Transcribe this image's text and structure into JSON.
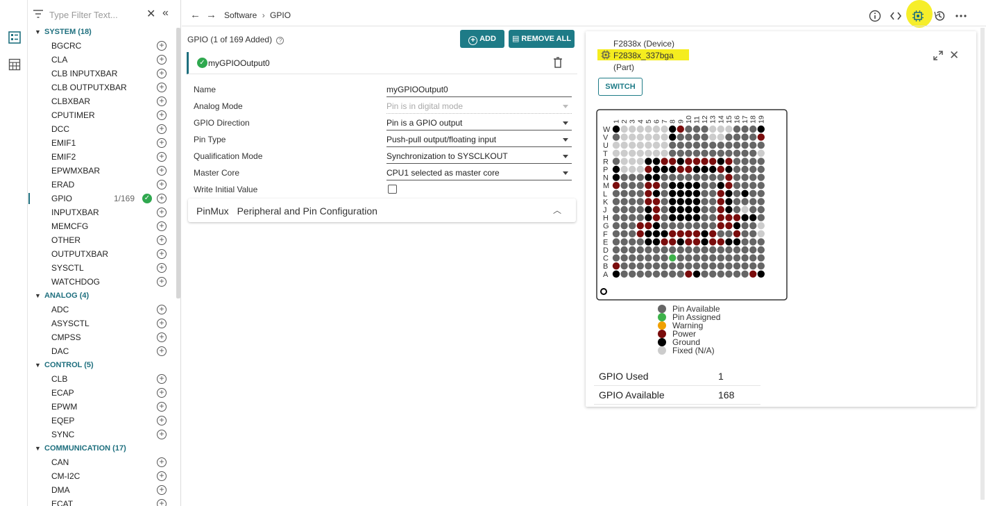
{
  "sidebar": {
    "filter_placeholder": "Type Filter Text...",
    "groups": [
      {
        "label": "SYSTEM (18)",
        "items": [
          "BGCRC",
          "CLA",
          "CLB INPUTXBAR",
          "CLB OUTPUTXBAR",
          "CLBXBAR",
          "CPUTIMER",
          "DCC",
          "EMIF1",
          "EMIF2",
          "EPWMXBAR",
          "ERAD",
          "GPIO",
          "INPUTXBAR",
          "MEMCFG",
          "OTHER",
          "OUTPUTXBAR",
          "SYSCTL",
          "WATCHDOG"
        ]
      },
      {
        "label": "ANALOG (4)",
        "items": [
          "ADC",
          "ASYSCTL",
          "CMPSS",
          "DAC"
        ]
      },
      {
        "label": "CONTROL (5)",
        "items": [
          "CLB",
          "ECAP",
          "EPWM",
          "EQEP",
          "SYNC"
        ]
      },
      {
        "label": "COMMUNICATION (17)",
        "items": [
          "CAN",
          "CM-I2C",
          "DMA",
          "ECAT"
        ]
      }
    ],
    "active_item": "GPIO",
    "active_count": "1/169"
  },
  "topbar": {
    "breadcrumb_root": "Software",
    "breadcrumb_sep": "›",
    "breadcrumb_page": "GPIO"
  },
  "gpio": {
    "title": "GPIO (1 of 169 Added)",
    "add_label": "ADD",
    "remove_all_label": "REMOVE ALL",
    "instance_name": "myGPIOOutput0",
    "properties": [
      {
        "label": "Name",
        "value": "myGPIOOutput0",
        "kind": "text"
      },
      {
        "label": "Analog Mode",
        "value": "Pin is in digital mode",
        "kind": "select-disabled"
      },
      {
        "label": "GPIO Direction",
        "value": "Pin is a GPIO output",
        "kind": "select"
      },
      {
        "label": "Pin Type",
        "value": "Push-pull output/floating input",
        "kind": "select"
      },
      {
        "label": "Qualification Mode",
        "value": "Synchronization to SYSCLKOUT",
        "kind": "select"
      },
      {
        "label": "Master Core",
        "value": "CPU1 selected as master core",
        "kind": "select"
      },
      {
        "label": "Write Initial Value",
        "value": "",
        "kind": "checkbox"
      }
    ],
    "pinmux_title": "PinMux",
    "pinmux_subtitle": "Peripheral and Pin Configuration"
  },
  "device": {
    "device_label": "F2838x (Device)",
    "part_name": "F2838x_337bga",
    "part_sub": "(Part)",
    "switch_label": "SWITCH",
    "highlight_color": "#f5ed1f",
    "accent_color": "#1e7b87",
    "legend": [
      {
        "label": "Pin Available",
        "color": "#666666"
      },
      {
        "label": "Pin Assigned",
        "color": "#3db24a"
      },
      {
        "label": "Warning",
        "color": "#f0a000"
      },
      {
        "label": "Power",
        "color": "#7a0c0c"
      },
      {
        "label": "Ground",
        "color": "#000000"
      },
      {
        "label": "Fixed (N/A)",
        "color": "#cccccc"
      }
    ],
    "stats": [
      {
        "label": "GPIO Used",
        "value": "1"
      },
      {
        "label": "GPIO Available",
        "value": "168"
      }
    ]
  },
  "chart_data": {
    "type": "heatmap",
    "columns": [
      "1",
      "2",
      "3",
      "4",
      "5",
      "6",
      "7",
      "8",
      "9",
      "10",
      "11",
      "12",
      "13",
      "14",
      "15",
      "16",
      "17",
      "18",
      "19"
    ],
    "rows": [
      "W",
      "V",
      "U",
      "T",
      "R",
      "P",
      "N",
      "M",
      "L",
      "K",
      "J",
      "H",
      "G",
      "F",
      "E",
      "D",
      "C",
      "B",
      "A"
    ],
    "legend_codes": {
      "a": "Pin Available",
      "s": "Pin Assigned",
      "p": "Power",
      "g": "Ground",
      "f": "Fixed (N/A)"
    },
    "grid": [
      "gffffffgpaaafffaaag",
      "affffffgaaaaffaaaap",
      "fffffffaaaaaaaaaaaa",
      "fffffffaaaaaaaaaaaf",
      "afffggppgppppgpaaaa",
      "gfffpgggppgggpgaaaa",
      "gaaaggaaaaaaaapaaaa",
      "paaappaggggaagpaaaa",
      "aaaapgaggggaapgagaa",
      "aaaappaggggaapgaaaa",
      "aaaagpaggggaapgafaa",
      "aaaagpaggggaapppgga",
      "aaappgaaaaaaappgaaf",
      "aaapgggppppgpaapaaf",
      "aaaaggppgppgppggaaa",
      "aaaaaaaaaaaaaaaaaaa",
      "aaaaaaasaaaaaaaaaaa",
      "paaaaaaaaaaaaaaaaaa",
      "gaaaaaaaapgaaaaaapg"
    ]
  }
}
